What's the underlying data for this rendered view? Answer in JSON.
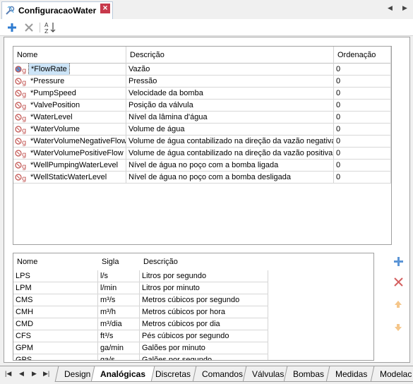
{
  "window": {
    "title": "ConfiguracaoWater"
  },
  "toolbar": {
    "add": "add-icon",
    "delete": "delete-icon",
    "sort": "sort-az-icon",
    "sort_label_top": "A",
    "sort_label_bottom": "Z"
  },
  "grid1": {
    "headers": {
      "name": "Nome",
      "description": "Descrição",
      "order": "Ordenação"
    },
    "rows": [
      {
        "name": "*FlowRate",
        "description": "Vazão",
        "order": "0"
      },
      {
        "name": "*Pressure",
        "description": "Pressão",
        "order": "0"
      },
      {
        "name": "*PumpSpeed",
        "description": "Velocidade da bomba",
        "order": "0"
      },
      {
        "name": "*ValvePosition",
        "description": "Posição da válvula",
        "order": "0"
      },
      {
        "name": "*WaterLevel",
        "description": "Nível da lâmina d'água",
        "order": "0"
      },
      {
        "name": "*WaterVolume",
        "description": "Volume de água",
        "order": "0"
      },
      {
        "name": "*WaterVolumeNegativeFlow",
        "description": "Volume de água contabilizado na direção da vazão negativa",
        "order": "0"
      },
      {
        "name": "*WaterVolumePositiveFlow",
        "description": "Volume de água contabilizado na direção da vazão positiva",
        "order": "0"
      },
      {
        "name": "*WellPumpingWaterLevel",
        "description": "Nível de água no poço com a bomba ligada",
        "order": "0"
      },
      {
        "name": "*WellStaticWaterLevel",
        "description": "Nível de água no poço com a bomba desligada",
        "order": "0"
      }
    ]
  },
  "grid2": {
    "headers": {
      "name": "Nome",
      "sigla": "Sigla",
      "description": "Descrição"
    },
    "rows": [
      {
        "name": "LPS",
        "sigla": "l/s",
        "description": "Litros por segundo"
      },
      {
        "name": "LPM",
        "sigla": "l/min",
        "description": "Litros por minuto"
      },
      {
        "name": "CMS",
        "sigla": "m³/s",
        "description": "Metros cúbicos por segundo"
      },
      {
        "name": "CMH",
        "sigla": "m³/h",
        "description": "Metros cúbicos por hora"
      },
      {
        "name": "CMD",
        "sigla": "m³/dia",
        "description": "Metros cúbicos por dia"
      },
      {
        "name": "CFS",
        "sigla": "ft³/s",
        "description": "Pés cúbicos por segundo"
      },
      {
        "name": "GPM",
        "sigla": "ga/min",
        "description": "Galões por minuto"
      },
      {
        "name": "GPS",
        "sigla": "ga/s",
        "description": "Galões por segundo"
      }
    ]
  },
  "sheet_tabs": [
    "Design",
    "Analógicas",
    "Discretas",
    "Comandos",
    "Válvulas",
    "Bombas",
    "Medidas",
    "Modelac"
  ],
  "active_tab": "Analógicas",
  "colors": {
    "accent_blue": "#2e7bd0",
    "close_red": "#c7394b",
    "selection": "#cce4f7"
  }
}
